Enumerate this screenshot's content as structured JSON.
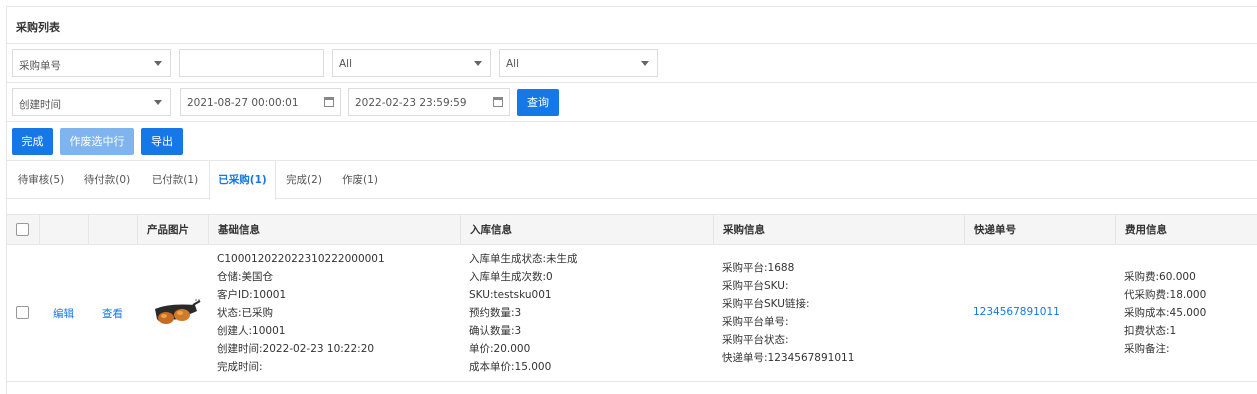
{
  "page_title": "采购列表",
  "filters": {
    "search_type": "采购单号",
    "search_value": "",
    "select_a": "All",
    "select_b": "All",
    "date_type": "创建时间",
    "date_from": "2021-08-27 00:00:01",
    "date_to": "2022-02-23 23:59:59",
    "query_label": "查询"
  },
  "actions": {
    "complete_label": "完成",
    "void_label": "作废选中行",
    "export_label": "导出"
  },
  "tabs": [
    {
      "label": "待审核(5)"
    },
    {
      "label": "待付款(0)"
    },
    {
      "label": "已付款(1)"
    },
    {
      "label": "已采购(1)"
    },
    {
      "label": "完成(2)"
    },
    {
      "label": "作废(1)"
    }
  ],
  "active_tab": "已采购(1)",
  "table": {
    "headers": [
      "产品图片",
      "基础信息",
      "入库信息",
      "采购信息",
      "快递单号",
      "费用信息"
    ],
    "rows": [
      {
        "edit_label": "编辑",
        "view_label": "查看",
        "basic": [
          "C100012022022310222000001",
          "仓储:美国仓",
          "客户ID:10001",
          "状态:已采购",
          "创建人:10001",
          "创建时间:2022-02-23 10:22:20",
          "完成时间:"
        ],
        "inbound": [
          "入库单生成状态:未生成",
          "入库单生成次数:0",
          "SKU:testsku001",
          "预约数量:3",
          "确认数量:3",
          "单价:20.000",
          "成本单价:15.000"
        ],
        "purchase": [
          "采购平台:1688",
          "采购平台SKU:",
          "采购平台SKU链接:",
          "采购平台单号:",
          "采购平台状态:",
          "快递单号:1234567891011"
        ],
        "tracking": "1234567891011",
        "fees": [
          "采购费:60.000",
          "代采购费:18.000",
          "采购成本:45.000",
          "扣费状态:1",
          "采购备注:"
        ]
      }
    ]
  },
  "colors": {
    "primary": "#1677e6",
    "primary_disabled": "#7fb4ef",
    "border": "#e6e6e6",
    "header_bg": "#f5f5f5"
  }
}
